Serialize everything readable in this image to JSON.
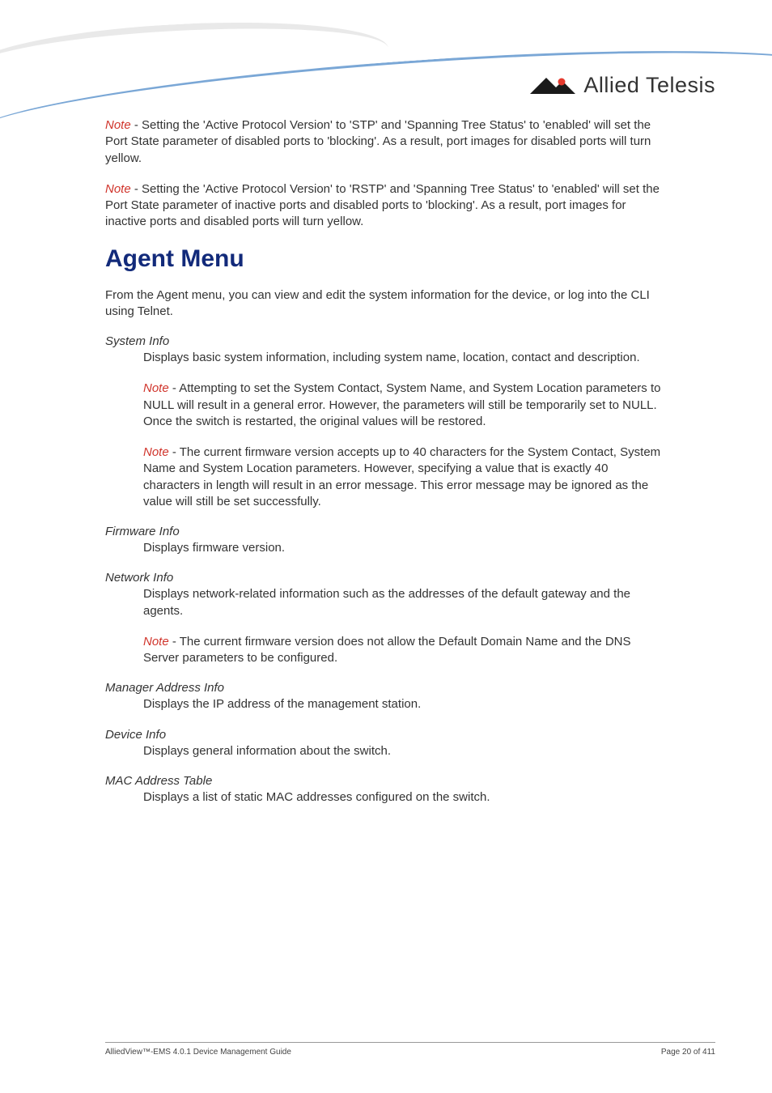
{
  "brand": {
    "name": "Allied Telesis"
  },
  "notes": {
    "top1": {
      "label": "Note",
      "text": " - Setting the 'Active Protocol Version' to 'STP' and 'Spanning Tree Status' to 'enabled' will set the Port State parameter of disabled ports to 'blocking'. As a result, port images for disabled ports will turn yellow."
    },
    "top2": {
      "label": "Note",
      "text": " - Setting the 'Active Protocol Version' to 'RSTP' and 'Spanning Tree Status' to 'enabled' will set the Port State parameter of inactive ports and disabled ports to 'blocking'. As a result, port images for inactive ports and disabled ports will turn yellow."
    }
  },
  "heading": "Agent Menu",
  "intro": "From the Agent menu, you can view and edit the system information for the device, or log into the CLI using Telnet.",
  "sections": {
    "system_info": {
      "title": "System Info",
      "desc": "Displays basic system information, including system name, location, contact and description.",
      "note1": {
        "label": "Note",
        "text": " - Attempting to set the System Contact, System Name, and System Location parameters to NULL will result in a general error. However, the parameters will still be temporarily set to NULL. Once the switch is restarted, the original values will be restored."
      },
      "note2": {
        "label": "Note",
        "text": " - The current firmware version accepts up to 40 characters for the System Contact, System Name and System Location parameters. However, specifying a value that is exactly 40 characters in length will result in an error message. This error message may be ignored as the value will still be set successfully."
      }
    },
    "firmware_info": {
      "title": "Firmware Info",
      "desc": "Displays firmware version."
    },
    "network_info": {
      "title": "Network Info",
      "desc": "Displays network-related information such as the addresses of the default gateway and the agents.",
      "note1": {
        "label": "Note",
        "text": " - The current firmware version does not allow the Default Domain Name and the DNS Server parameters to be configured."
      }
    },
    "manager_address_info": {
      "title": "Manager Address Info",
      "desc": "Displays the IP address of the management station."
    },
    "device_info": {
      "title": "Device Info",
      "desc": "Displays general information about the switch."
    },
    "mac_address_table": {
      "title": "MAC Address Table",
      "desc": "Displays a list of static MAC addresses configured on the switch."
    }
  },
  "footer": {
    "left": "AlliedView™-EMS 4.0.1 Device Management Guide",
    "right": "Page 20 of 411"
  }
}
